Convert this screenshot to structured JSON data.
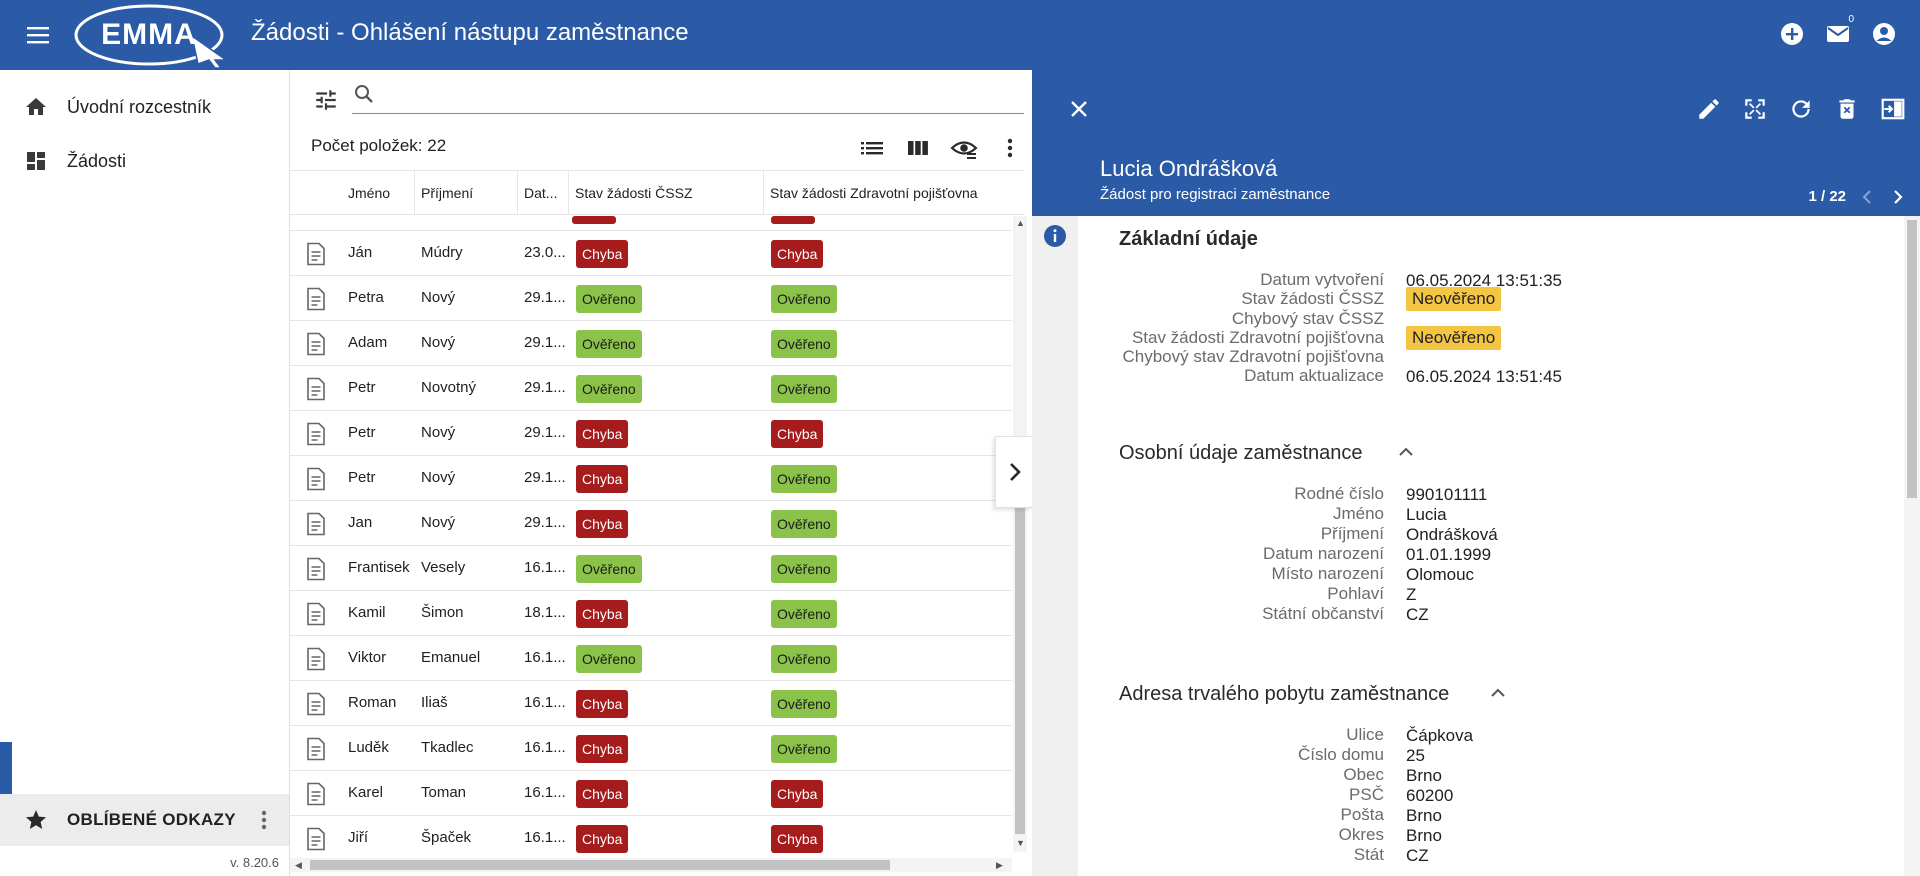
{
  "appbar": {
    "logo_text": "EMMA",
    "title": "Žádosti - Ohlášení nástupu zaměstnance",
    "mail_badge": "0"
  },
  "sidebar": {
    "items": [
      {
        "label": "Úvodní rozcestník",
        "icon": "home-icon"
      },
      {
        "label": "Žádosti",
        "icon": "dashboard-icon"
      }
    ],
    "favorites_label": "OBLÍBENÉ ODKAZY",
    "version": "v. 8.20.6"
  },
  "list": {
    "search_placeholder": "",
    "count_label": "Počet položek: 22",
    "columns": [
      "Jméno",
      "Příjmení",
      "Dat...",
      "Stav žádosti ČSSZ",
      "Stav žádosti Zdravotní pojišťovna"
    ],
    "rows": [
      {
        "first": "Ján",
        "last": "Múdry",
        "date": "23.0...",
        "cssz": "Chyba",
        "zp": "Chyba"
      },
      {
        "first": "Petra",
        "last": "Nový",
        "date": "29.1...",
        "cssz": "Ověřeno",
        "zp": "Ověřeno"
      },
      {
        "first": "Adam",
        "last": "Nový",
        "date": "29.1...",
        "cssz": "Ověřeno",
        "zp": "Ověřeno"
      },
      {
        "first": "Petr",
        "last": "Novotný",
        "date": "29.1...",
        "cssz": "Ověřeno",
        "zp": "Ověřeno"
      },
      {
        "first": "Petr",
        "last": "Nový",
        "date": "29.1...",
        "cssz": "Chyba",
        "zp": "Chyba"
      },
      {
        "first": "Petr",
        "last": "Nový",
        "date": "29.1...",
        "cssz": "Chyba",
        "zp": "Ověřeno"
      },
      {
        "first": "Jan",
        "last": "Nový",
        "date": "29.1...",
        "cssz": "Chyba",
        "zp": "Ověřeno"
      },
      {
        "first": "Frantisek",
        "last": "Vesely",
        "date": "16.1...",
        "cssz": "Ověřeno",
        "zp": "Ověřeno"
      },
      {
        "first": "Kamil",
        "last": "Šimon",
        "date": "18.1...",
        "cssz": "Chyba",
        "zp": "Ověřeno"
      },
      {
        "first": "Viktor",
        "last": "Emanuel",
        "date": "16.1...",
        "cssz": "Ověřeno",
        "zp": "Ověřeno"
      },
      {
        "first": "Roman",
        "last": "Iliaš",
        "date": "16.1...",
        "cssz": "Chyba",
        "zp": "Ověřeno"
      },
      {
        "first": "Luděk",
        "last": "Tkadlec",
        "date": "16.1...",
        "cssz": "Chyba",
        "zp": "Ověřeno"
      },
      {
        "first": "Karel",
        "last": "Toman",
        "date": "16.1...",
        "cssz": "Chyba",
        "zp": "Chyba"
      },
      {
        "first": "Jiří",
        "last": "Špaček",
        "date": "16.1...",
        "cssz": "Chyba",
        "zp": "Chyba"
      }
    ]
  },
  "detail": {
    "name": "Lucia Ondrášková",
    "subtitle": "Žádost pro registraci zaměstnance",
    "pager": "1 / 22",
    "sections": [
      {
        "title": "Základní údaje",
        "fields": [
          {
            "label": "Datum vytvoření",
            "value": "06.05.2024 13:51:35"
          },
          {
            "label": "Stav žádosti ČSSZ",
            "value": "Neověřeno",
            "chip": true
          },
          {
            "label": "Chybový stav ČSSZ",
            "value": ""
          },
          {
            "label": "Stav žádosti Zdravotní pojišťovna",
            "value": "Neověřeno",
            "chip": true
          },
          {
            "label": "Chybový stav Zdravotní pojišťovna",
            "value": ""
          },
          {
            "label": "Datum aktualizace",
            "value": "06.05.2024 13:51:45"
          }
        ]
      },
      {
        "title": "Osobní údaje zaměstnance",
        "fields": [
          {
            "label": "Rodné číslo",
            "value": "990101111"
          },
          {
            "label": "Jméno",
            "value": "Lucia"
          },
          {
            "label": "Příjmení",
            "value": "Ondrášková"
          },
          {
            "label": "Datum narození",
            "value": "01.01.1999"
          },
          {
            "label": "Místo narození",
            "value": "Olomouc"
          },
          {
            "label": "Pohlaví",
            "value": "Z"
          },
          {
            "label": "Státní občanství",
            "value": "CZ"
          }
        ]
      },
      {
        "title": "Adresa trvalého pobytu zaměstnance",
        "fields": [
          {
            "label": "Ulice",
            "value": "Čápkova"
          },
          {
            "label": "Číslo domu",
            "value": "25"
          },
          {
            "label": "Obec",
            "value": "Brno"
          },
          {
            "label": "PSČ",
            "value": "60200"
          },
          {
            "label": "Pošta",
            "value": "Brno"
          },
          {
            "label": "Okres",
            "value": "Brno"
          },
          {
            "label": "Stát",
            "value": "CZ"
          }
        ]
      }
    ]
  },
  "colors": {
    "primary": "#2b5aa6",
    "error_chip": "#a61b1b",
    "ok_chip": "#8bc34a",
    "warning_chip": "#f4c542"
  }
}
